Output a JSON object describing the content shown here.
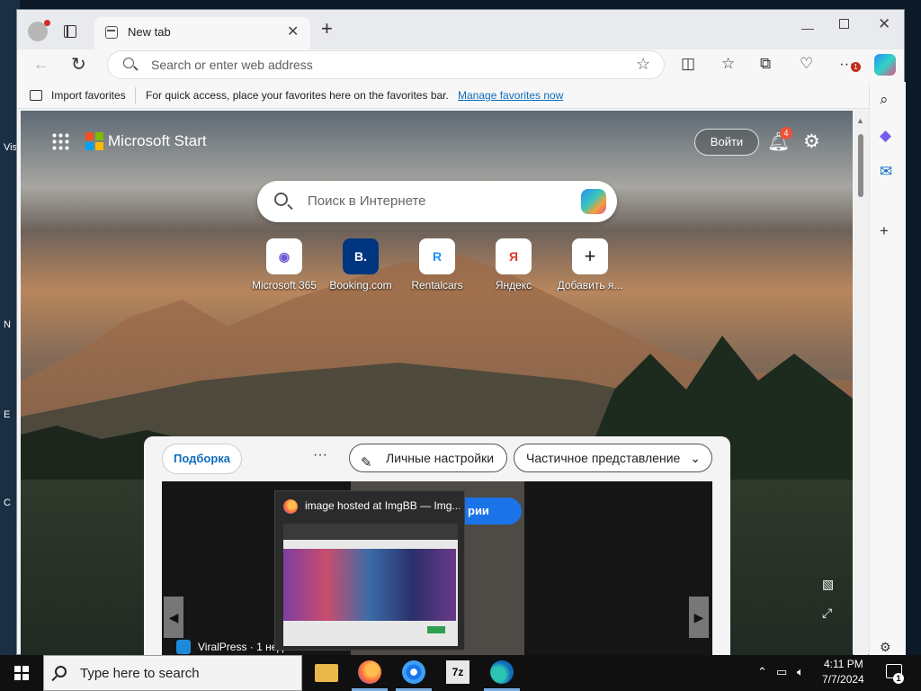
{
  "desktop": {
    "labels": [
      "Vis",
      "N",
      "E",
      "C"
    ]
  },
  "browser": {
    "tab_title": "New tab",
    "address_placeholder": "Search or enter web address",
    "favorites_bar": {
      "import_label": "Import favorites",
      "message": "For quick access, place your favorites here on the favorites bar.",
      "manage_link": "Manage favorites now"
    },
    "extension_badge_count": "1"
  },
  "newtab": {
    "brand": "Microsoft Start",
    "login_button": "Войти",
    "notification_count": "4",
    "search_placeholder": "Поиск в Интернете",
    "quick_links": [
      {
        "label": "Microsoft 365",
        "icon": "microsoft-365-icon",
        "glyph": "◉",
        "color": "#6b5bd6"
      },
      {
        "label": "Booking.com",
        "icon": "booking-icon",
        "glyph": "B.",
        "color": "#003580"
      },
      {
        "label": "Rentalcars",
        "icon": "rentalcars-icon",
        "glyph": "R",
        "color": "#1f8fff"
      },
      {
        "label": "Яндекс",
        "icon": "yandex-icon",
        "glyph": "Я",
        "color": "#e2382c"
      },
      {
        "label": "Добавить я...",
        "icon": "plus-icon",
        "glyph": "+",
        "color": "#333333"
      }
    ],
    "feed": {
      "tab_label": "Подборка",
      "more_label": "···",
      "personalize_label": "Личные настройки",
      "view_label": "Частичное представление",
      "card_source": "ViralPress · 1 нед",
      "card_button_fragment": "рии"
    }
  },
  "taskbar_preview": {
    "title": "image hosted at ImgBB — Img..."
  },
  "taskbar": {
    "search_placeholder": "Type here to search",
    "time": "4:11 PM",
    "date": "7/7/2024",
    "notification_count": "1"
  }
}
